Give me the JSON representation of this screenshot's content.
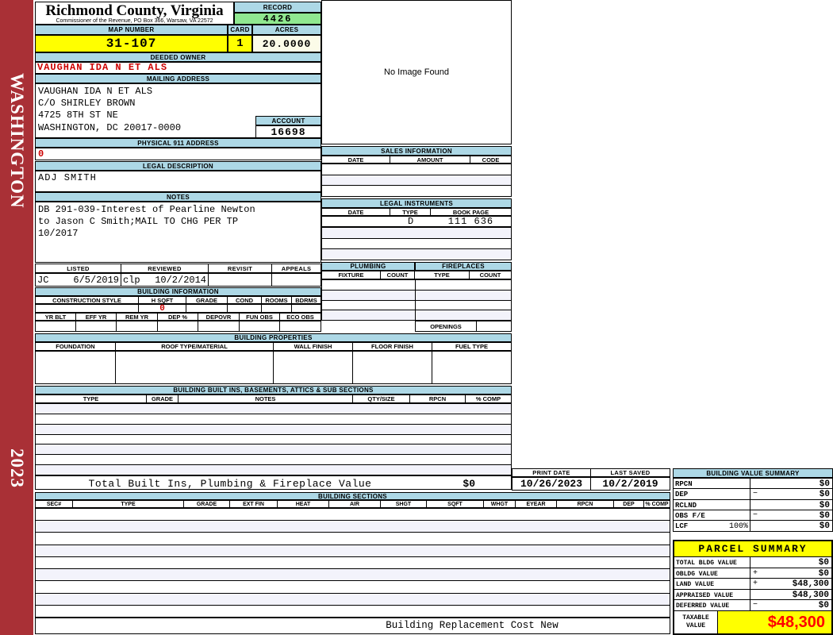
{
  "colors": {
    "band": "#ADD8E6",
    "yellow": "#FFFF00",
    "green": "#90E890",
    "ivory": "#FBFBE8",
    "sidebar": "#A93036",
    "redtext": "#CC0000",
    "brightred": "#FF0000",
    "rowtint": "#F3F3FB"
  },
  "sidebar": {
    "district": "WASHINGTON",
    "year": "2023"
  },
  "header": {
    "county": "Richmond County, Virginia",
    "address_line": "Commissioner of the Revenue, PO Box 366, Warsaw, VA 22572",
    "record_label": "RECORD",
    "record_value": "4426",
    "map_number_label": "MAP NUMBER",
    "map_number": "31-107",
    "card_label": "CARD",
    "card": "1",
    "acres_label": "ACRES",
    "acres": "20.0000"
  },
  "owner": {
    "deeded_owner_label": "DEEDED OWNER",
    "deeded_owner": "VAUGHAN IDA N ET ALS",
    "mailing_address_label": "MAILING ADDRESS",
    "mailing_lines": [
      "VAUGHAN IDA N ET ALS",
      "C/O SHIRLEY BROWN",
      "4725 8TH ST NE",
      "WASHINGTON, DC 20017-0000"
    ],
    "account_label": "ACCOUNT",
    "account": "16698",
    "physical_label": "PHYSICAL 911 ADDRESS",
    "physical": "0",
    "legal_label": "LEGAL DESCRIPTION",
    "legal": "ADJ SMITH",
    "notes_label": "NOTES",
    "notes_lines": [
      "DB 291-039-Interest of Pearline Newton",
      "to Jason C Smith;MAIL TO CHG PER TP",
      "10/2017"
    ]
  },
  "visits": {
    "headers": [
      "LISTED",
      "REVIEWED",
      "REVISIT",
      "APPEALS"
    ],
    "listed_by": "JC",
    "listed_date": "6/5/2019",
    "reviewed_by": "clp",
    "reviewed_date": "10/2/2014",
    "revisit": "",
    "appeals": ""
  },
  "building_info": {
    "title": "BUILDING INFORMATION",
    "row1_headers": [
      "CONSTRUCTION STYLE",
      "H SQFT",
      "GRADE",
      "COND",
      "ROOMS",
      "BDRMS"
    ],
    "row1_values": [
      "",
      "0",
      "",
      "",
      "",
      ""
    ],
    "row2_headers": [
      "YR BLT",
      "EFF YR",
      "REM YR",
      "DEP %",
      "DEPOVR",
      "FUN OBS",
      "ECO OBS"
    ],
    "row2_values": [
      "",
      "",
      "",
      "",
      "",
      "",
      ""
    ]
  },
  "building_properties": {
    "title": "BUILDING PROPERTIES",
    "headers": [
      "FOUNDATION",
      "ROOF TYPE/MATERIAL",
      "WALL FINISH",
      "FLOOR FINISH",
      "FUEL TYPE"
    ]
  },
  "built_ins": {
    "title": "BUILDING BUILT INS, BASEMENTS, ATTICS & SUB SECTIONS",
    "headers": [
      "TYPE",
      "GRADE",
      "NOTES",
      "QTY/SIZE",
      "RPCN",
      "% COMP"
    ],
    "total_label": "Total Built Ins, Plumbing & Fireplace Value",
    "total_value": "$0"
  },
  "image_box": {
    "text": "No Image Found"
  },
  "sales": {
    "title": "SALES INFORMATION",
    "headers": [
      "DATE",
      "AMOUNT",
      "CODE"
    ]
  },
  "instruments": {
    "title": "LEGAL INSTRUMENTS",
    "headers": [
      "DATE",
      "TYPE",
      "BOOK PAGE"
    ],
    "row1": {
      "date": "",
      "type": "D",
      "book_page": "111 636"
    }
  },
  "plumbing": {
    "title": "PLUMBING",
    "headers": [
      "FIXTURE",
      "COUNT"
    ]
  },
  "fireplaces": {
    "title": "FIREPLACES",
    "headers": [
      "TYPE",
      "COUNT"
    ],
    "openings_label": "OPENINGS"
  },
  "dates": {
    "print_label": "PRINT DATE",
    "print": "10/26/2023",
    "saved_label": "LAST SAVED",
    "saved": "10/2/2019"
  },
  "building_value_summary": {
    "title": "BUILDING VALUE SUMMARY",
    "rows": [
      {
        "label": "RPCN",
        "op": "",
        "value": "$0"
      },
      {
        "label": "DEP",
        "op": "−",
        "value": "$0"
      },
      {
        "label": "RCLND",
        "op": "",
        "value": "$0"
      },
      {
        "label": "OBS F/E",
        "op": "−",
        "value": "$0"
      },
      {
        "label": "LCF",
        "pct": "100%",
        "op": "",
        "value": "$0"
      }
    ]
  },
  "building_sections": {
    "title": "BUILDING SECTIONS",
    "headers": [
      "SEC#",
      "TYPE",
      "GRADE",
      "EXT FIN",
      "HEAT",
      "AIR",
      "SHGT",
      "SQFT",
      "WHGT",
      "EYEAR",
      "RPCN",
      "DEP",
      "% COMP"
    ],
    "footer": "Building Replacement Cost New"
  },
  "parcel_summary": {
    "title": "PARCEL SUMMARY",
    "rows": [
      {
        "label": "TOTAL BLDG VALUE",
        "op": "",
        "value": "$0"
      },
      {
        "label": "OBLDG VALUE",
        "op": "+",
        "value": "$0"
      },
      {
        "label": "LAND VALUE",
        "op": "+",
        "value": "$48,300"
      },
      {
        "label": "APPRAISED VALUE",
        "op": "",
        "value": "$48,300"
      },
      {
        "label": "DEFERRED VALUE",
        "op": "−",
        "value": "$0"
      }
    ],
    "taxable_label": "TAXABLE VALUE",
    "taxable_value": "$48,300"
  }
}
